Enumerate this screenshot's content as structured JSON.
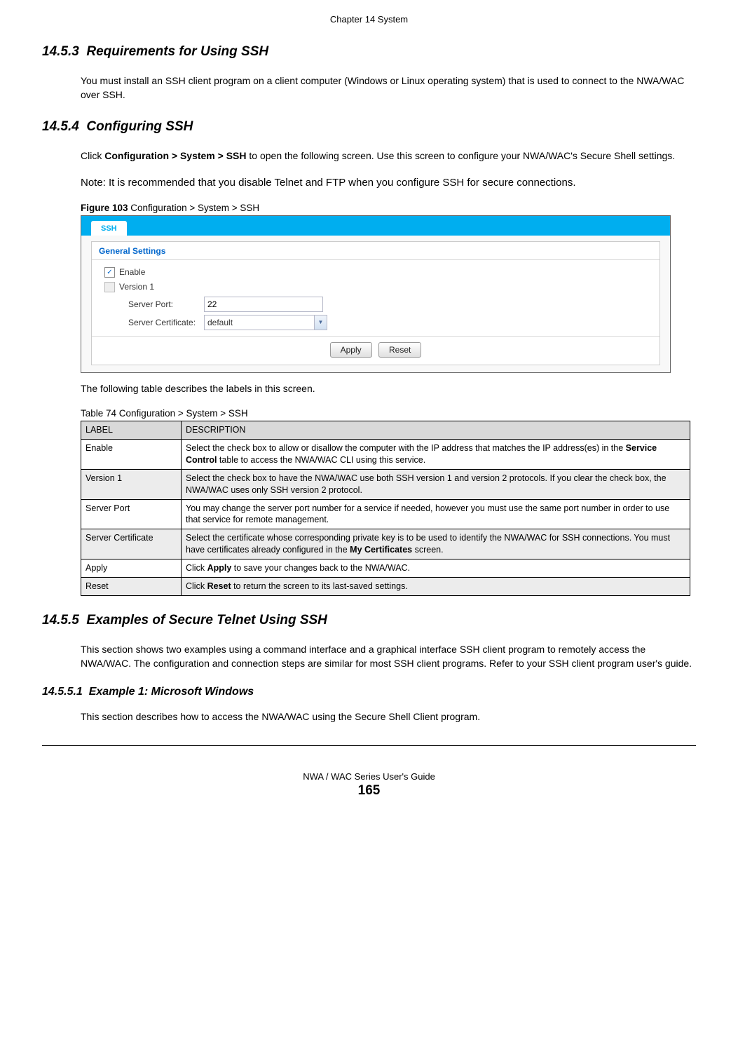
{
  "chapter_header": " Chapter 14 System",
  "section_1453": {
    "num": "14.5.3",
    "title": "Requirements for Using SSH",
    "body": "You must install an SSH client program on a client computer (Windows or Linux operating system) that is used to connect to the NWA/WAC over SSH."
  },
  "section_1454": {
    "num": "14.5.4",
    "title": "Configuring SSH",
    "body_before_bold": "Click ",
    "body_bold": "Configuration > System > SSH",
    "body_after_bold": " to open the following screen. Use this screen to configure your NWA/WAC's Secure Shell settings.",
    "note": "Note: It is recommended that you disable Telnet and FTP when you configure SSH for secure connections."
  },
  "figure": {
    "label_bold": "Figure 103",
    "label_text": "   Configuration > System > SSH",
    "tab": "SSH",
    "panel_title": "General Settings",
    "enable_label": "Enable",
    "enable_checked": true,
    "version1_label": "Version 1",
    "version1_checked": false,
    "server_port_label": "Server Port:",
    "server_port_value": "22",
    "server_cert_label": "Server Certificate:",
    "server_cert_value": "default",
    "apply": "Apply",
    "reset": "Reset"
  },
  "table_intro": "The following table describes the labels in this screen.",
  "table": {
    "caption": "Table 74   Configuration > System > SSH",
    "head_label": "LABEL",
    "head_desc": "DESCRIPTION",
    "rows": [
      {
        "label": "Enable",
        "desc_before": "Select the check box to allow or disallow the computer with the IP address that matches the IP address(es) in the ",
        "desc_bold": "Service Control",
        "desc_after": " table to access the NWA/WAC CLI using this service."
      },
      {
        "label": "Version 1",
        "desc": "Select the check box to have the NWA/WAC use both SSH version 1 and version 2 protocols. If you clear the check box, the NWA/WAC uses only SSH version 2 protocol."
      },
      {
        "label": "Server Port",
        "desc": "You may change the server port number for a service if needed, however you must use the same port number in order to use that service for remote management."
      },
      {
        "label": "Server Certificate",
        "desc_before": "Select the certificate whose corresponding private key is to be used to identify the NWA/WAC for SSH connections. You must have certificates already configured in the ",
        "desc_bold": "My Certificates",
        "desc_after": " screen."
      },
      {
        "label": "Apply",
        "desc_before": "Click ",
        "desc_bold": "Apply",
        "desc_after": " to save your changes back to the NWA/WAC."
      },
      {
        "label": "Reset",
        "desc_before": "Click ",
        "desc_bold": "Reset",
        "desc_after": " to return the screen to its last-saved settings."
      }
    ]
  },
  "section_1455": {
    "num": "14.5.5",
    "title": "Examples of Secure Telnet Using SSH",
    "body": "This section shows two examples using a command interface and a graphical interface SSH client program to remotely access the NWA/WAC. The configuration and connection steps are similar for most SSH client programs. Refer to your SSH client program user's guide."
  },
  "section_14551": {
    "num": "14.5.5.1",
    "title": "Example 1: Microsoft Windows",
    "body": "This section describes how to access the NWA/WAC using the Secure Shell Client program."
  },
  "footer": {
    "guide": "NWA / WAC Series User's Guide",
    "page": "165"
  }
}
